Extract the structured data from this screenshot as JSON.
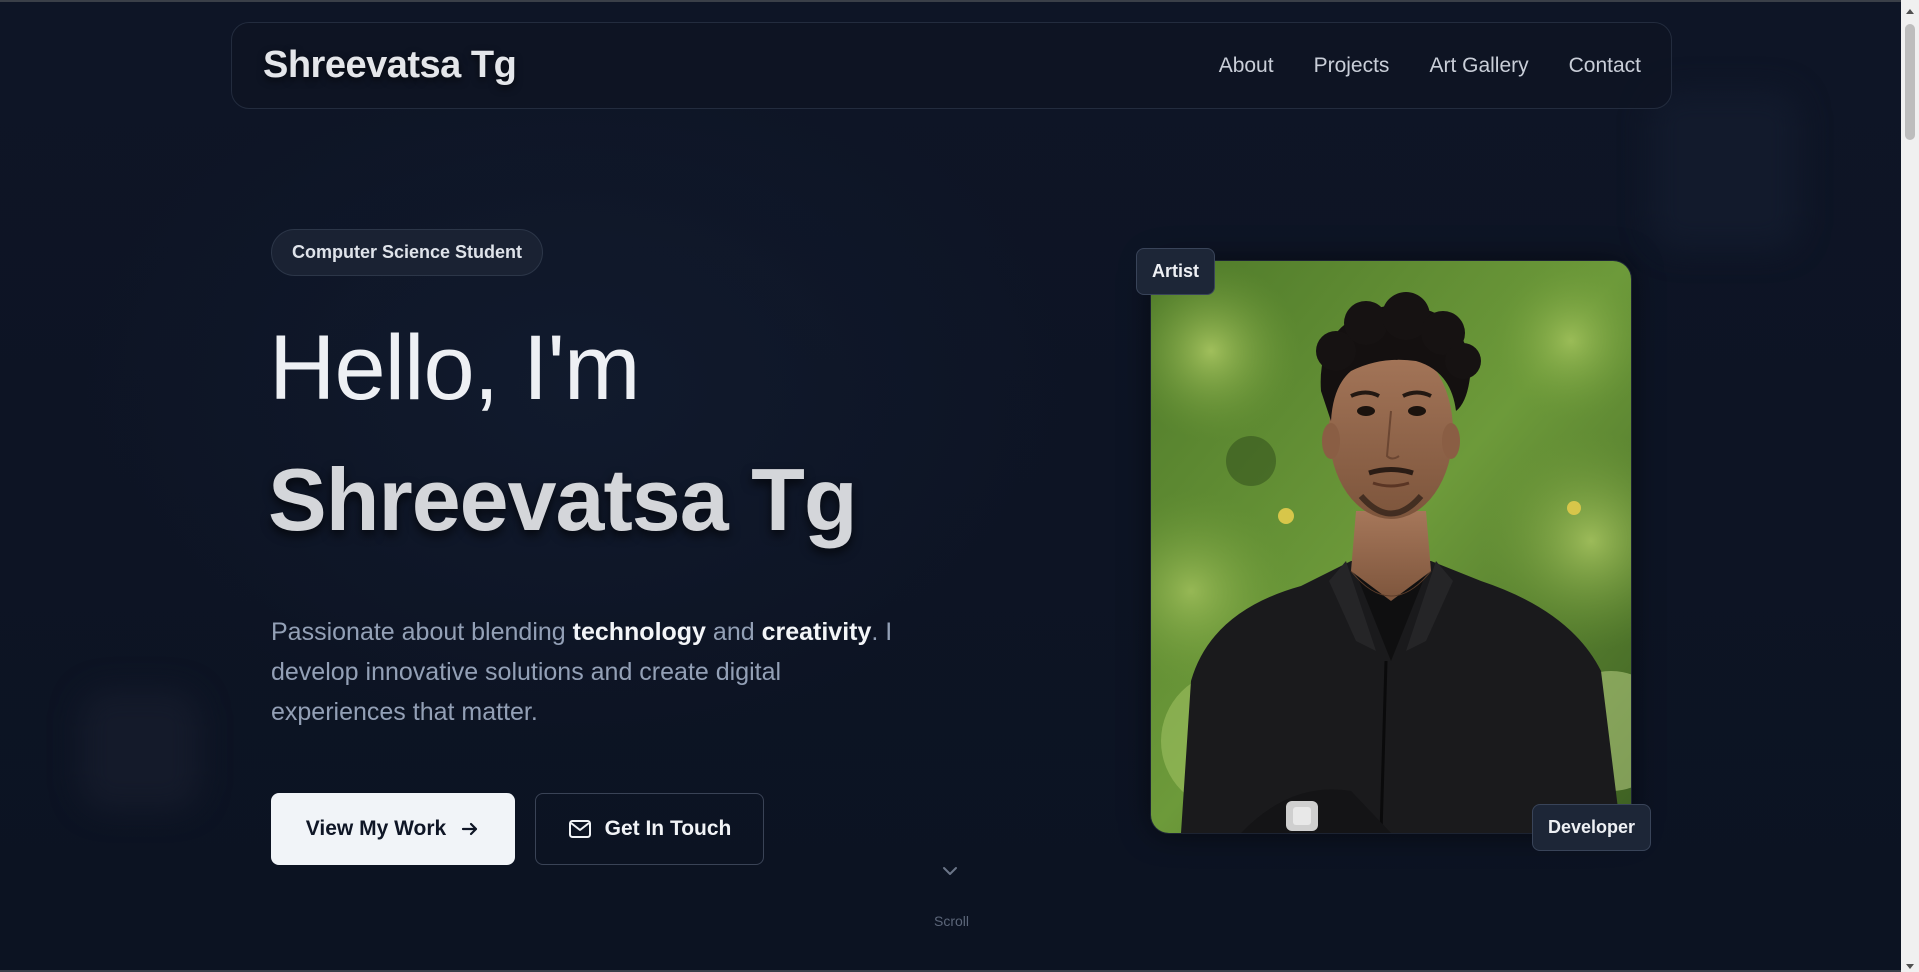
{
  "nav": {
    "brand": "Shreevatsa Tg",
    "links": [
      "About",
      "Projects",
      "Art Gallery",
      "Contact"
    ]
  },
  "hero": {
    "badge": "Computer Science Student",
    "greeting": "Hello, I'm",
    "name": "Shreevatsa Tg",
    "intro": {
      "p1": "Passionate about blending ",
      "b1": "technology",
      "p2": " and ",
      "b2": "creativity",
      "p3": ". I develop innovative solutions and create digital experiences that matter."
    },
    "primary_button": "View My Work",
    "secondary_button": "Get In Touch",
    "scroll_label": "Scroll"
  },
  "portrait": {
    "tag_top": "Artist",
    "tag_bottom": "Developer"
  },
  "colors": {
    "background": "#0d1424",
    "primary_button_bg": "#f1f4f8",
    "muted_text": "#93a0b6"
  },
  "icons": {
    "primary_button": "arrow-right-icon",
    "secondary_button": "mail-icon",
    "scroll": "chevron-down-icon"
  }
}
